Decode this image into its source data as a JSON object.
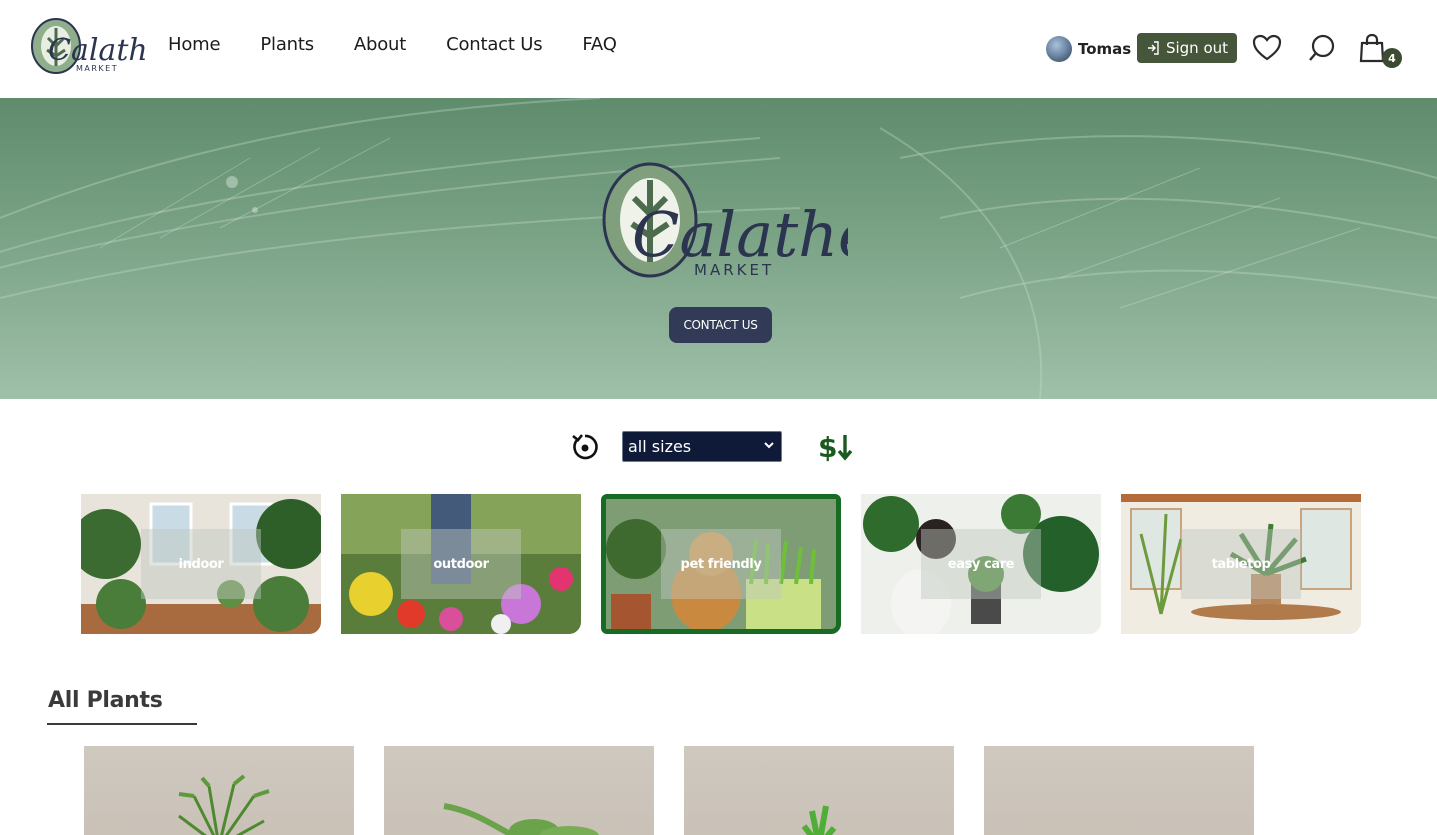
{
  "header": {
    "logo": {
      "brand": "Calathea",
      "sub": "MARKET"
    },
    "nav": [
      "Home",
      "Plants",
      "About",
      "Contact Us",
      "FAQ"
    ],
    "user_name": "Tomas",
    "signout_label": "Sign out",
    "cart_count": "4",
    "icons": [
      "heart-icon",
      "search-icon",
      "shopping-bag-icon"
    ]
  },
  "hero": {
    "logo": {
      "brand": "Calathea",
      "sub": "MARKET"
    },
    "contact_label": "CONTACT US"
  },
  "controls": {
    "size_selected": "all sizes",
    "sort_label": "$"
  },
  "categories": [
    {
      "label": "indoor"
    },
    {
      "label": "outdoor"
    },
    {
      "label": "pet friendly",
      "selected": true
    },
    {
      "label": "easy care"
    },
    {
      "label": "tabletop"
    }
  ],
  "section": {
    "title": "All Plants"
  },
  "colors": {
    "accent": "#46563a",
    "hero": "#7aa285",
    "selected_border": "#176b25",
    "select_bg": "#0f1a38"
  }
}
